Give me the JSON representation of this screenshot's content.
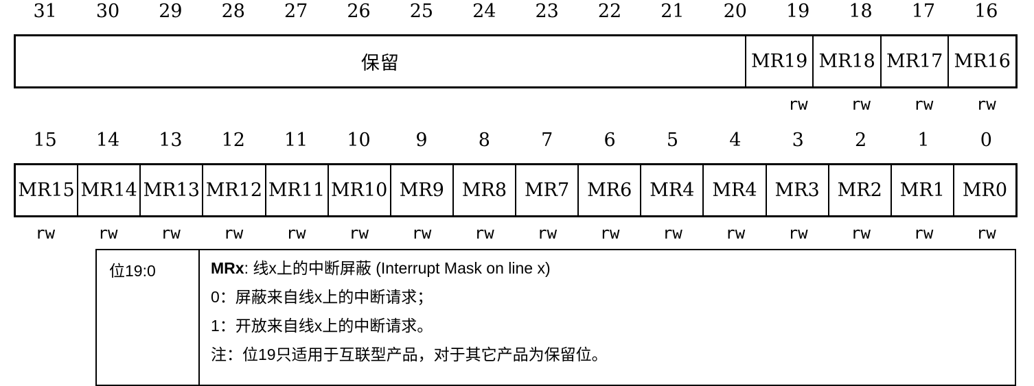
{
  "bit_numbers_high": [
    "31",
    "30",
    "29",
    "28",
    "27",
    "26",
    "25",
    "24",
    "23",
    "22",
    "21",
    "20",
    "19",
    "18",
    "17",
    "16"
  ],
  "bit_numbers_low": [
    "15",
    "14",
    "13",
    "12",
    "11",
    "10",
    "9",
    "8",
    "7",
    "6",
    "5",
    "4",
    "3",
    "2",
    "1",
    "0"
  ],
  "register_high": {
    "reserved_label": "保留",
    "fields": [
      "MR19",
      "MR18",
      "MR17",
      "MR16"
    ]
  },
  "register_low": {
    "fields": [
      "MR15",
      "MR14",
      "MR13",
      "MR12",
      "MR11",
      "MR10",
      "MR9",
      "MR8",
      "MR7",
      "MR6",
      "MR4",
      "MR4",
      "MR3",
      "MR2",
      "MR1",
      "MR0"
    ]
  },
  "access_high": [
    "",
    "",
    "",
    "",
    "",
    "",
    "",
    "",
    "",
    "",
    "",
    "",
    "rw",
    "rw",
    "rw",
    "rw"
  ],
  "access_low": [
    "rw",
    "rw",
    "rw",
    "rw",
    "rw",
    "rw",
    "rw",
    "rw",
    "rw",
    "rw",
    "rw",
    "rw",
    "rw",
    "rw",
    "rw",
    "rw"
  ],
  "description": {
    "bits": "位19:0",
    "field_name": "MRx",
    "field_title": ": 线x上的中断屏蔽 (Interrupt Mask on line x)",
    "line0": "0：屏蔽来自线x上的中断请求；",
    "line1": "1：开放来自线x上的中断请求。",
    "note": "注：位19只适用于互联型产品，对于其它产品为保留位。"
  }
}
